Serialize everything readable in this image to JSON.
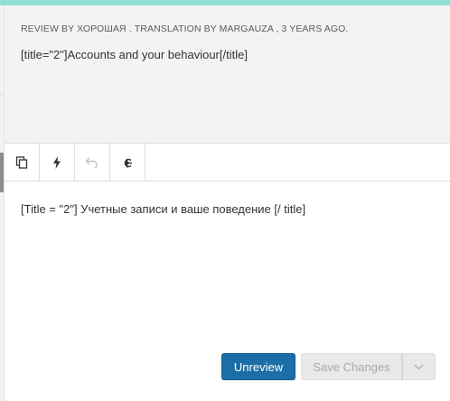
{
  "review": {
    "meta": "REVIEW BY ХОРОШАЯ . TRANSLATION BY MARGAUZA , 3 YEARS AGO.",
    "source_text": "[title=\"2\"]Accounts and your behaviour[/title]"
  },
  "toolbar": {
    "tools": [
      {
        "name": "copy-source",
        "icon": "copy-icon",
        "enabled": true
      },
      {
        "name": "auto-translate",
        "icon": "lightning-icon",
        "enabled": true
      },
      {
        "name": "undo",
        "icon": "undo-icon",
        "enabled": false
      },
      {
        "name": "special-characters",
        "icon": "ampersand-icon",
        "enabled": true
      }
    ]
  },
  "editor": {
    "translation_text": "[Title = \"2\"] Учетные записи и ваше поведение [/ title]"
  },
  "actions": {
    "unreview_label": "Unreview",
    "save_label": "Save Changes",
    "save_enabled": false,
    "dropdown_icon": "chevron-down-icon"
  },
  "colors": {
    "accent": "#8fe0d4",
    "primary": "#1c6fa6",
    "disabled_bg": "#e9e9e9",
    "disabled_text": "#a9a9a9",
    "panel_bg": "#f3f3f3"
  }
}
